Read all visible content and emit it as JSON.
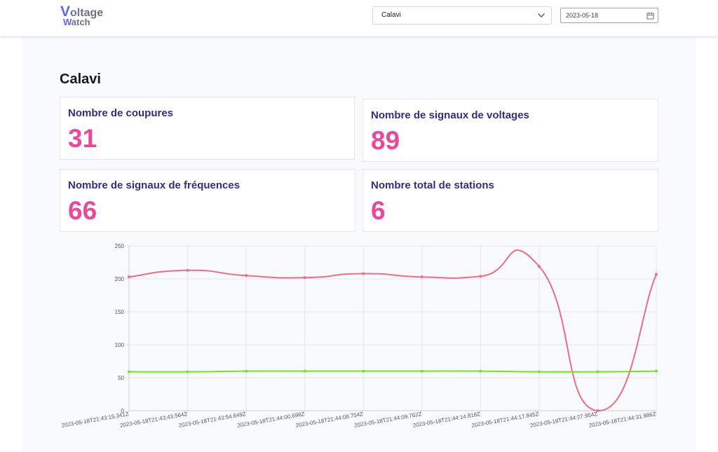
{
  "header": {
    "logo": {
      "first_letter": "V",
      "first_rest": "oltage",
      "second_letter": "W",
      "second_rest": "atch"
    },
    "station_select": {
      "value": "Calavi",
      "icon": "chevron-down-icon"
    },
    "date_input": {
      "value": "2023-05-18",
      "icon": "calendar-icon"
    }
  },
  "page": {
    "title": "Calavi"
  },
  "stats": [
    {
      "label": "Nombre de coupures",
      "value": "31"
    },
    {
      "label": "Nombre de signaux de voltages",
      "value": "89"
    },
    {
      "label": "Nombre de signaux de fréquences",
      "value": "66"
    },
    {
      "label": "Nombre total de stations",
      "value": "6"
    }
  ],
  "colors": {
    "accent": "#6366f1",
    "stat_value": "#ec4899",
    "stat_label": "#312e81",
    "voltage_line": "#f06a8a",
    "frequency_line": "#6ee626"
  },
  "chart_data": {
    "type": "line",
    "x": [
      "2023-05-18T21:43:15.341Z",
      "2023-05-18T21:43:43.564Z",
      "2023-05-18T21:43:54.649Z",
      "2023-05-18T21:44:00.698Z",
      "2023-05-18T21:44:08.754Z",
      "2023-05-18T21:44:09.762Z",
      "2023-05-18T21:44:14.818Z",
      "2023-05-18T21:44:17.845Z",
      "2023-05-18T21:44:27.954Z",
      "2023-05-18T21:44:31.986Z"
    ],
    "series": [
      {
        "values": [
          203,
          213,
          205,
          202,
          208,
          203,
          204,
          219,
          0,
          207
        ],
        "color": "#f06a8a"
      },
      {
        "values": [
          59,
          59,
          60,
          60,
          60,
          60,
          60,
          59,
          59,
          60
        ],
        "color": "#6ee626"
      }
    ],
    "ylim": [
      0,
      250
    ],
    "yticks": [
      "0",
      "50",
      "100",
      "150",
      "200",
      "250"
    ],
    "grid": true,
    "legend": "none"
  }
}
